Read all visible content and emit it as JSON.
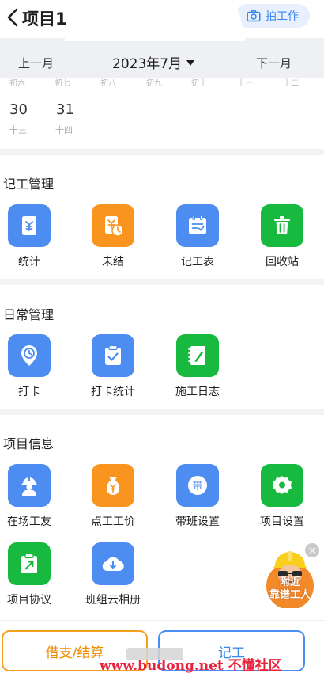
{
  "header": {
    "title": "项目1",
    "photo_label": "拍工作"
  },
  "month_nav": {
    "prev": "上一月",
    "current": "2023年7月",
    "next": "下一月"
  },
  "calendar": {
    "lunar_top": [
      "初六",
      "初七",
      "初八",
      "初九",
      "初十",
      "十一",
      "十二"
    ],
    "days": [
      {
        "day": "30",
        "lunar": "十三"
      },
      {
        "day": "31",
        "lunar": "十四"
      }
    ]
  },
  "sections": [
    {
      "title": "记工管理",
      "items": [
        {
          "label": "统计",
          "icon": "statistics-icon",
          "color": "#4d8df1"
        },
        {
          "label": "未结",
          "icon": "unsettled-icon",
          "color": "#f9941e"
        },
        {
          "label": "记工表",
          "icon": "work-sheet-icon",
          "color": "#4d8df1"
        },
        {
          "label": "回收站",
          "icon": "trash-icon",
          "color": "#17b93e"
        }
      ]
    },
    {
      "title": "日常管理",
      "items": [
        {
          "label": "打卡",
          "icon": "clock-in-icon",
          "color": "#4d8df1"
        },
        {
          "label": "打卡统计",
          "icon": "clock-stats-icon",
          "color": "#4d8df1"
        },
        {
          "label": "施工日志",
          "icon": "construction-log-icon",
          "color": "#17b93e"
        }
      ]
    },
    {
      "title": "项目信息",
      "items": [
        {
          "label": "在场工友",
          "icon": "worker-icon",
          "color": "#4d8df1"
        },
        {
          "label": "点工工价",
          "icon": "price-bag-icon",
          "color": "#f9941e"
        },
        {
          "label": "带班设置",
          "icon": "team-lead-icon",
          "color": "#4d8df1"
        },
        {
          "label": "项目设置",
          "icon": "settings-icon",
          "color": "#17b93e"
        },
        {
          "label": "项目协议",
          "icon": "agreement-icon",
          "color": "#17b93e"
        },
        {
          "label": "班组云相册",
          "icon": "cloud-album-icon",
          "color": "#4d8df1"
        }
      ]
    }
  ],
  "float_ad": {
    "line1": "附近",
    "line2": "靠谱工人",
    "close": "×"
  },
  "bottom": {
    "loan_label": "借支/结算",
    "record_label": "记工"
  },
  "watermark": "www.budong.net 不懂社区"
}
